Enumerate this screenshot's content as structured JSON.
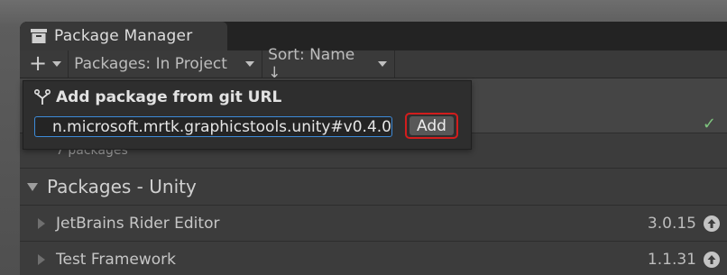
{
  "window": {
    "title": "Package Manager",
    "icon": "package-manager-icon"
  },
  "toolbar": {
    "add_symbol": "+",
    "packages_filter": "Packages: In Project",
    "sort": "Sort: Name ↓"
  },
  "popup": {
    "title": "Add package from git URL",
    "url_value": "n.microsoft.mrtk.graphicstools.unity#v0.4.0",
    "add_label": "Add"
  },
  "list": {
    "selected_row_count": "7 packages",
    "group_label": "Packages - Unity",
    "packages": [
      {
        "name": "JetBrains Rider Editor",
        "version": "3.0.15"
      },
      {
        "name": "Test Framework",
        "version": "1.1.31"
      }
    ]
  },
  "colors": {
    "focus_border": "#3d8bd9",
    "highlight_box": "#d21d1d",
    "checkmark": "#7ec47e"
  }
}
